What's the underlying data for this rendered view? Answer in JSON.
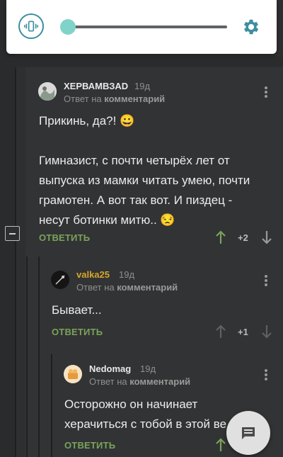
{
  "volume": {
    "level": 0.03,
    "mode_icon": "vibrate-icon",
    "settings_icon": "gear-icon",
    "accent_color": "#3d8ea0"
  },
  "comments": [
    {
      "username": "ХЕРВАМВЗАD",
      "age": "19д",
      "reply_prefix": "Ответ на",
      "reply_target": "комментарий",
      "text": "Прикинь, да?! 😀\n\nГимназист, с почти четырёх лет от выпуска из мамки читать умею, почти грамотен. А вот так вот. И пиздец - несут ботинки митю.. 😒",
      "reply_label": "ОТВЕТИТЬ",
      "rating": "+2",
      "upvoted": true
    },
    {
      "username": "valka25",
      "age": "19д",
      "reply_prefix": "Ответ на",
      "reply_target": "комментарий",
      "text": "Бывает...",
      "reply_label": "ОТВЕТИТЬ",
      "rating": "+1",
      "upvoted": false
    },
    {
      "username": "Nedomag",
      "age": "19д",
      "reply_prefix": "Ответ на",
      "reply_target": "комментарий",
      "text": "Осторожно он начинает херачиться с тобой в этой ве",
      "reply_label": "ОТВЕТИТЬ",
      "upvoted": true
    }
  ],
  "colors": {
    "reply_link": "#7aa35a",
    "username_gold": "#d4a72c",
    "upvote_green": "#7aa35a"
  },
  "fab": {
    "icon": "chat-icon"
  }
}
